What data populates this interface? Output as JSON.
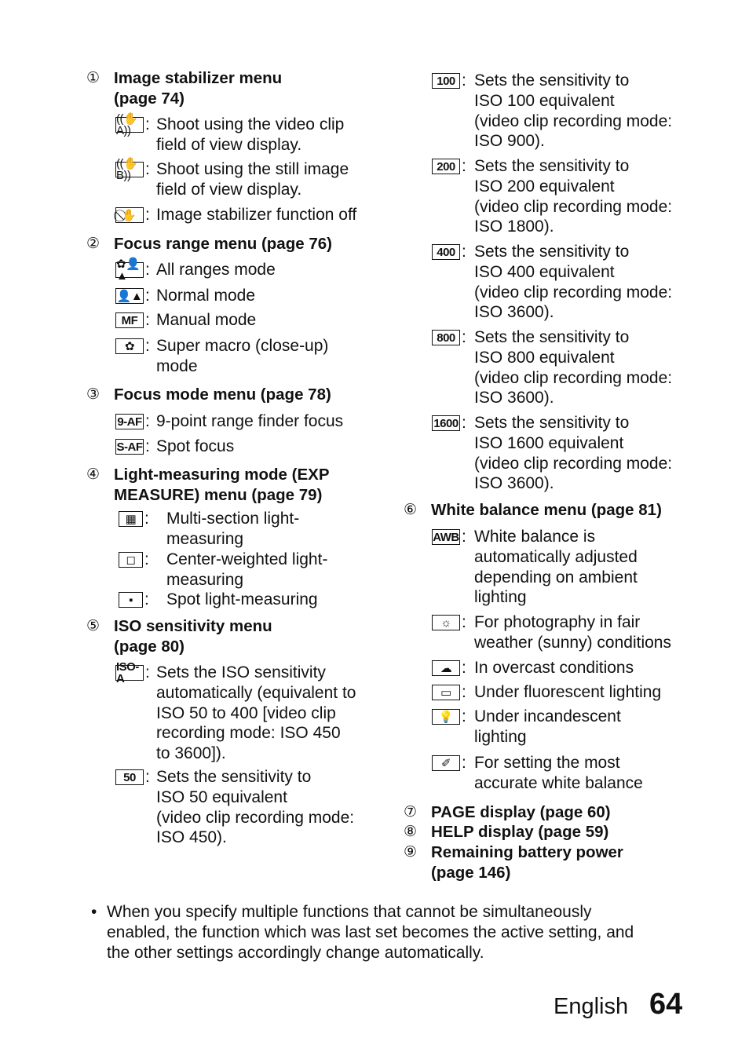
{
  "left_column": {
    "sections": [
      {
        "number": "①",
        "heading": [
          "Image stabilizer menu",
          "(page 74)"
        ],
        "items": [
          {
            "icon": "stabilizer-video-icon",
            "icon_text": "((✋A))",
            "text": [
              "Shoot using the video clip",
              "field of view display."
            ]
          },
          {
            "icon": "stabilizer-still-icon",
            "icon_text": "((✋B))",
            "text": [
              "Shoot using the still image",
              "field of view display."
            ]
          },
          {
            "icon": "stabilizer-off-icon",
            "icon_text": "⃠✋",
            "text": [
              "Image stabilizer function off"
            ]
          }
        ]
      },
      {
        "number": "②",
        "heading": [
          "Focus range menu (page 76)"
        ],
        "items": [
          {
            "icon": "all-ranges-icon",
            "icon_text": "✿👤▲",
            "text": [
              "All ranges mode"
            ]
          },
          {
            "icon": "normal-mode-icon",
            "icon_text": "👤▲",
            "text": [
              "Normal mode"
            ]
          },
          {
            "icon": "manual-focus-icon",
            "icon_text": "MF",
            "text": [
              "Manual mode"
            ]
          },
          {
            "icon": "super-macro-icon",
            "icon_text": "✿",
            "text": [
              "Super macro (close-up)",
              "mode"
            ]
          }
        ]
      },
      {
        "number": "③",
        "heading": [
          "Focus mode menu (page 78)"
        ],
        "items": [
          {
            "icon": "9-point-af-icon",
            "icon_text": "9-AF",
            "text": [
              "9-point range finder focus"
            ]
          },
          {
            "icon": "spot-af-icon",
            "icon_text": "S-AF",
            "text": [
              "Spot focus"
            ]
          }
        ]
      },
      {
        "number": "④",
        "heading": [
          "Light-measuring mode (EXP",
          "MEASURE) menu (page 79)"
        ],
        "items": [
          {
            "icon": "multi-section-metering-icon",
            "icon_text": "▦",
            "text": [
              "Multi-section light-",
              "measuring"
            ]
          },
          {
            "icon": "center-weighted-metering-icon",
            "icon_text": "◻",
            "text": [
              "Center-weighted light-",
              "measuring"
            ]
          },
          {
            "icon": "spot-metering-icon",
            "icon_text": "▪",
            "text": [
              "Spot light-measuring"
            ]
          }
        ]
      },
      {
        "number": "⑤",
        "heading": [
          "ISO sensitivity menu",
          "(page 80)"
        ],
        "items": [
          {
            "icon": "iso-auto-icon",
            "icon_text": "ISO-A",
            "text": [
              "Sets the ISO sensitivity",
              "automatically (equivalent to",
              "ISO 50 to 400 [video clip",
              "recording mode: ISO 450",
              "to 3600])."
            ]
          },
          {
            "icon": "iso-50-icon",
            "icon_text": "50",
            "text": [
              "Sets the sensitivity to",
              "ISO 50 equivalent",
              "(video clip recording mode:",
              "ISO 450)."
            ]
          }
        ]
      }
    ]
  },
  "right_column": {
    "iso_items": [
      {
        "icon": "iso-100-icon",
        "icon_text": "100",
        "text": [
          "Sets the sensitivity to",
          "ISO 100 equivalent",
          "(video clip recording mode:",
          "ISO 900)."
        ]
      },
      {
        "icon": "iso-200-icon",
        "icon_text": "200",
        "text": [
          "Sets the sensitivity to",
          "ISO 200 equivalent",
          "(video clip recording mode:",
          "ISO 1800)."
        ]
      },
      {
        "icon": "iso-400-icon",
        "icon_text": "400",
        "text": [
          "Sets the sensitivity to",
          "ISO 400 equivalent",
          "(video clip recording mode:",
          "ISO 3600)."
        ]
      },
      {
        "icon": "iso-800-icon",
        "icon_text": "800",
        "text": [
          "Sets the sensitivity to",
          "ISO 800 equivalent",
          "(video clip recording mode:",
          "ISO 3600)."
        ]
      },
      {
        "icon": "iso-1600-icon",
        "icon_text": "1600",
        "text": [
          "Sets the sensitivity to",
          "ISO 1600 equivalent",
          "(video clip recording mode:",
          "ISO 3600)."
        ]
      }
    ],
    "sections": [
      {
        "number": "⑥",
        "heading": [
          "White balance menu (page 81)"
        ],
        "items": [
          {
            "icon": "auto-white-balance-icon",
            "icon_text": "AWB",
            "text": [
              "White balance is",
              "automatically adjusted",
              "depending on ambient",
              "lighting"
            ]
          },
          {
            "icon": "sunny-icon",
            "icon_text": "☼",
            "text": [
              "For photography in fair",
              "weather (sunny) conditions"
            ]
          },
          {
            "icon": "cloudy-icon",
            "icon_text": "☁",
            "text": [
              "In overcast conditions"
            ]
          },
          {
            "icon": "fluorescent-icon",
            "icon_text": "▭",
            "text": [
              "Under fluorescent lighting"
            ]
          },
          {
            "icon": "incandescent-icon",
            "icon_text": "💡",
            "text": [
              "Under incandescent",
              "lighting"
            ]
          },
          {
            "icon": "custom-white-balance-icon",
            "icon_text": "✐",
            "text": [
              "For setting the most",
              "accurate white balance"
            ]
          }
        ]
      },
      {
        "number": "⑦",
        "heading": [
          "PAGE display (page 60)"
        ],
        "items": []
      },
      {
        "number": "⑧",
        "heading": [
          "HELP display (page 59)"
        ],
        "items": []
      },
      {
        "number": "⑨",
        "heading": [
          "Remaining battery power",
          "(page 146)"
        ],
        "items": []
      }
    ]
  },
  "note": {
    "bullet": "•",
    "lines": [
      "When you specify multiple functions that cannot be simultaneously",
      "enabled, the function which was last set becomes the active setting, and",
      "the other settings accordingly change automatically."
    ]
  },
  "footer": {
    "language": "English",
    "page_number": "64"
  }
}
